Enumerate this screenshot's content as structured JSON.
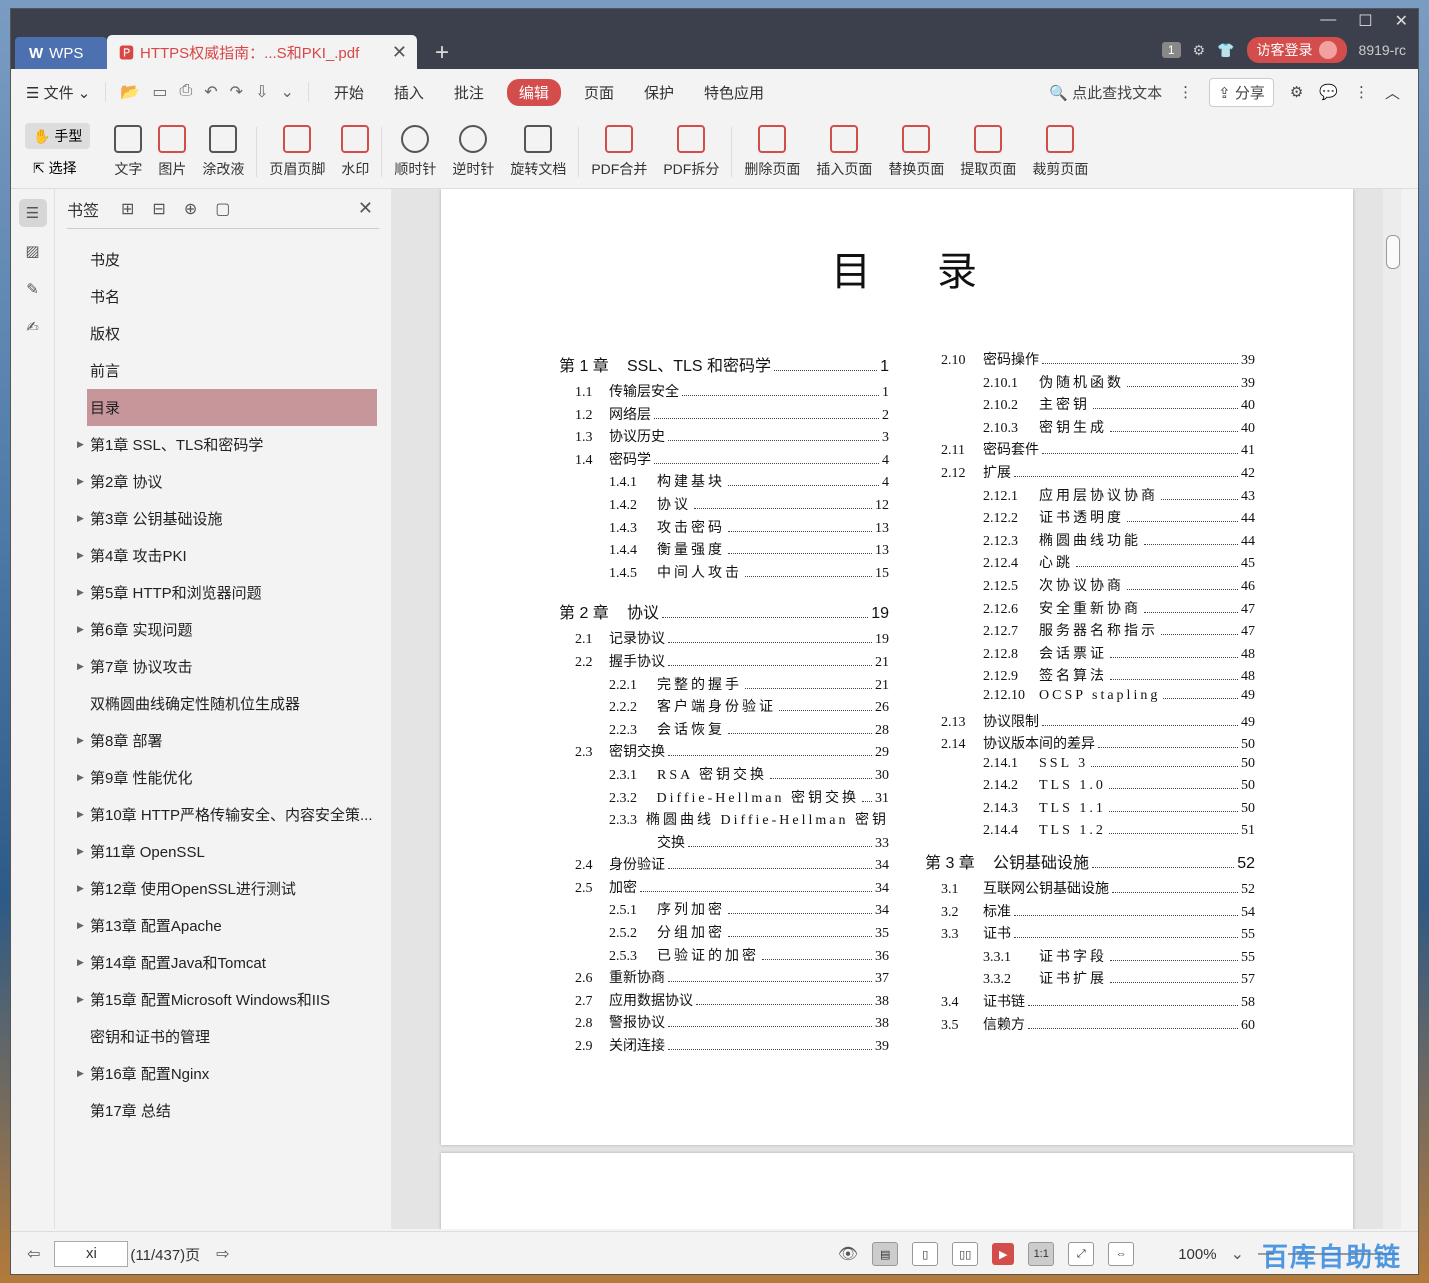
{
  "titlebar": {
    "app_tab": "WPS",
    "doc_tab": "HTTPS权威指南：...S和PKI_.pdf",
    "badge": "1",
    "login": "访客登录",
    "version": "8919-rc"
  },
  "menu": {
    "file": "文件",
    "items": [
      "开始",
      "插入",
      "批注",
      "编辑",
      "页面",
      "保护",
      "特色应用"
    ],
    "search": "点此查找文本",
    "share": "分享"
  },
  "toolbar": {
    "hand": "手型",
    "select": "选择",
    "tools": [
      "文字",
      "图片",
      "涂改液",
      "页眉页脚",
      "水印",
      "顺时针",
      "逆时针",
      "旋转文档",
      "PDF合并",
      "PDF拆分",
      "删除页面",
      "插入页面",
      "替换页面",
      "提取页面",
      "裁剪页面"
    ]
  },
  "bookmarks": {
    "title": "书签",
    "items": [
      {
        "label": "书皮",
        "arrow": false
      },
      {
        "label": "书名",
        "arrow": false
      },
      {
        "label": "版权",
        "arrow": false
      },
      {
        "label": "前言",
        "arrow": false
      },
      {
        "label": "目录",
        "arrow": false,
        "selected": true
      },
      {
        "label": "第1章 SSL、TLS和密码学",
        "arrow": true
      },
      {
        "label": "第2章 协议",
        "arrow": true
      },
      {
        "label": "第3章 公钥基础设施",
        "arrow": true
      },
      {
        "label": "第4章 攻击PKI",
        "arrow": true
      },
      {
        "label": "第5章 HTTP和浏览器问题",
        "arrow": true
      },
      {
        "label": "第6章 实现问题",
        "arrow": true
      },
      {
        "label": "第7章 协议攻击",
        "arrow": true
      },
      {
        "label": "双椭圆曲线确定性随机位生成器",
        "arrow": false
      },
      {
        "label": "第8章 部署",
        "arrow": true
      },
      {
        "label": "第9章 性能优化",
        "arrow": true
      },
      {
        "label": "第10章 HTTP严格传输安全、内容安全策...",
        "arrow": true
      },
      {
        "label": "第11章 OpenSSL",
        "arrow": true
      },
      {
        "label": "第12章 使用OpenSSL进行测试",
        "arrow": true
      },
      {
        "label": "第13章 配置Apache",
        "arrow": true
      },
      {
        "label": "第14章 配置Java和Tomcat",
        "arrow": true
      },
      {
        "label": "第15章 配置Microsoft Windows和IIS",
        "arrow": true
      },
      {
        "label": "密钥和证书的管理",
        "arrow": false
      },
      {
        "label": "第16章 配置Nginx",
        "arrow": true
      },
      {
        "label": "第17章 总结",
        "arrow": false
      }
    ]
  },
  "document": {
    "title": "目录",
    "col1": [
      {
        "t": "ch",
        "n": "第 1 章",
        "l": "SSL、TLS 和密码学",
        "p": "1"
      },
      {
        "t": "s1",
        "n": "1.1",
        "l": "传输层安全",
        "p": "1"
      },
      {
        "t": "s1",
        "n": "1.2",
        "l": "网络层",
        "p": "2"
      },
      {
        "t": "s1",
        "n": "1.3",
        "l": "协议历史",
        "p": "3"
      },
      {
        "t": "s1",
        "n": "1.4",
        "l": "密码学",
        "p": "4"
      },
      {
        "t": "s2",
        "n": "1.4.1",
        "l": "构建基块",
        "p": "4"
      },
      {
        "t": "s2",
        "n": "1.4.2",
        "l": "协议",
        "p": "12"
      },
      {
        "t": "s2",
        "n": "1.4.3",
        "l": "攻击密码",
        "p": "13"
      },
      {
        "t": "s2",
        "n": "1.4.4",
        "l": "衡量强度",
        "p": "13"
      },
      {
        "t": "s2",
        "n": "1.4.5",
        "l": "中间人攻击",
        "p": "15"
      },
      {
        "t": "sp"
      },
      {
        "t": "ch",
        "n": "第 2 章",
        "l": "协议",
        "p": "19"
      },
      {
        "t": "s1",
        "n": "2.1",
        "l": "记录协议",
        "p": "19"
      },
      {
        "t": "s1",
        "n": "2.2",
        "l": "握手协议",
        "p": "21"
      },
      {
        "t": "s2",
        "n": "2.2.1",
        "l": "完整的握手",
        "p": "21"
      },
      {
        "t": "s2",
        "n": "2.2.2",
        "l": "客户端身份验证",
        "p": "26"
      },
      {
        "t": "s2",
        "n": "2.2.3",
        "l": "会话恢复",
        "p": "28"
      },
      {
        "t": "s1",
        "n": "2.3",
        "l": "密钥交换",
        "p": "29"
      },
      {
        "t": "s2",
        "n": "2.3.1",
        "l": "RSA 密钥交换",
        "p": "30"
      },
      {
        "t": "s2",
        "n": "2.3.2",
        "l": "Diffie-Hellman 密钥交换",
        "p": "31"
      },
      {
        "t": "s2n",
        "n": "2.3.3",
        "l": "椭圆曲线 Diffie-Hellman 密钥",
        "p": ""
      },
      {
        "t": "cont",
        "n": "",
        "l": "交换",
        "p": "33"
      },
      {
        "t": "s1",
        "n": "2.4",
        "l": "身份验证",
        "p": "34"
      },
      {
        "t": "s1",
        "n": "2.5",
        "l": "加密",
        "p": "34"
      },
      {
        "t": "s2",
        "n": "2.5.1",
        "l": "序列加密",
        "p": "34"
      },
      {
        "t": "s2",
        "n": "2.5.2",
        "l": "分组加密",
        "p": "35"
      },
      {
        "t": "s2",
        "n": "2.5.3",
        "l": "已验证的加密",
        "p": "36"
      },
      {
        "t": "s1",
        "n": "2.6",
        "l": "重新协商",
        "p": "37"
      },
      {
        "t": "s1",
        "n": "2.7",
        "l": "应用数据协议",
        "p": "38"
      },
      {
        "t": "s1",
        "n": "2.8",
        "l": "警报协议",
        "p": "38"
      },
      {
        "t": "s1",
        "n": "2.9",
        "l": "关闭连接",
        "p": "39"
      }
    ],
    "col2": [
      {
        "t": "s1",
        "n": "2.10",
        "l": "密码操作",
        "p": "39"
      },
      {
        "t": "s2",
        "n": "2.10.1",
        "l": "伪随机函数",
        "p": "39"
      },
      {
        "t": "s2",
        "n": "2.10.2",
        "l": "主密钥",
        "p": "40"
      },
      {
        "t": "s2",
        "n": "2.10.3",
        "l": "密钥生成",
        "p": "40"
      },
      {
        "t": "s1",
        "n": "2.11",
        "l": "密码套件",
        "p": "41"
      },
      {
        "t": "s1",
        "n": "2.12",
        "l": "扩展",
        "p": "42"
      },
      {
        "t": "s2",
        "n": "2.12.1",
        "l": "应用层协议协商",
        "p": "43"
      },
      {
        "t": "s2",
        "n": "2.12.2",
        "l": "证书透明度",
        "p": "44"
      },
      {
        "t": "s2",
        "n": "2.12.3",
        "l": "椭圆曲线功能",
        "p": "44"
      },
      {
        "t": "s2",
        "n": "2.12.4",
        "l": "心跳",
        "p": "45"
      },
      {
        "t": "s2",
        "n": "2.12.5",
        "l": "次协议协商",
        "p": "46"
      },
      {
        "t": "s2",
        "n": "2.12.6",
        "l": "安全重新协商",
        "p": "47"
      },
      {
        "t": "s2",
        "n": "2.12.7",
        "l": "服务器名称指示",
        "p": "47"
      },
      {
        "t": "s2",
        "n": "2.12.8",
        "l": "会话票证",
        "p": "48"
      },
      {
        "t": "s2",
        "n": "2.12.9",
        "l": "签名算法",
        "p": "48"
      },
      {
        "t": "s2",
        "n": "2.12.10",
        "l": "OCSP stapling",
        "p": "49"
      },
      {
        "t": "s1",
        "n": "2.13",
        "l": "协议限制",
        "p": "49"
      },
      {
        "t": "s1",
        "n": "2.14",
        "l": "协议版本间的差异",
        "p": "50"
      },
      {
        "t": "s2",
        "n": "2.14.1",
        "l": "SSL 3",
        "p": "50"
      },
      {
        "t": "s2",
        "n": "2.14.2",
        "l": "TLS 1.0",
        "p": "50"
      },
      {
        "t": "s2",
        "n": "2.14.3",
        "l": "TLS 1.1",
        "p": "50"
      },
      {
        "t": "s2",
        "n": "2.14.4",
        "l": "TLS 1.2",
        "p": "51"
      },
      {
        "t": "ch",
        "n": "第 3 章",
        "l": "公钥基础设施",
        "p": "52"
      },
      {
        "t": "s1",
        "n": "3.1",
        "l": "互联网公钥基础设施",
        "p": "52"
      },
      {
        "t": "s1",
        "n": "3.2",
        "l": "标准",
        "p": "54"
      },
      {
        "t": "s1",
        "n": "3.3",
        "l": "证书",
        "p": "55"
      },
      {
        "t": "s2",
        "n": "3.3.1",
        "l": "证书字段",
        "p": "55"
      },
      {
        "t": "s2",
        "n": "3.3.2",
        "l": "证书扩展",
        "p": "57"
      },
      {
        "t": "s1",
        "n": "3.4",
        "l": "证书链",
        "p": "58"
      },
      {
        "t": "s1",
        "n": "3.5",
        "l": "信赖方",
        "p": "60"
      }
    ]
  },
  "status": {
    "page_input": "xi",
    "page_count": "(11/437)页",
    "zoom": "100%",
    "watermark": "百库自助链"
  }
}
